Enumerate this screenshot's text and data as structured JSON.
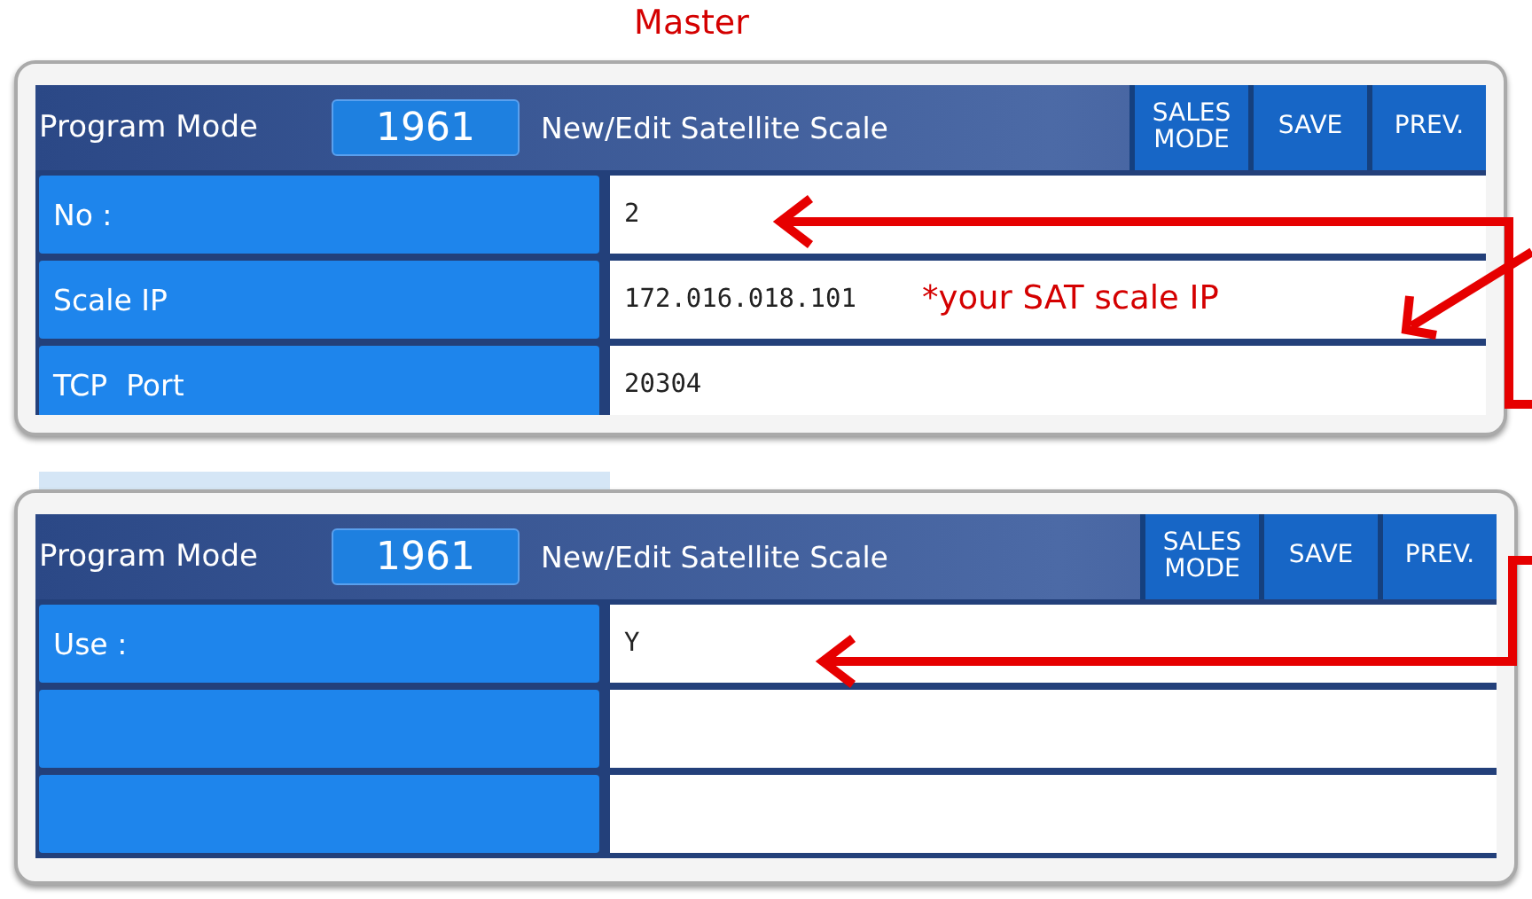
{
  "caption": "Master",
  "panels": [
    {
      "mode_label": "Program Mode",
      "code": "1961",
      "title": "New/Edit Satellite Scale",
      "buttons": [
        {
          "label": "SALES MODE"
        },
        {
          "label": "SAVE"
        },
        {
          "label": "PREV."
        }
      ],
      "rows": [
        {
          "label": "No :",
          "value": "2"
        },
        {
          "label": "Scale IP",
          "value": "172.016.018.101"
        },
        {
          "label": "TCP  Port",
          "value": "20304"
        }
      ]
    },
    {
      "mode_label": "Program Mode",
      "code": "1961",
      "title": "New/Edit Satellite Scale",
      "buttons": [
        {
          "label": "SALES MODE"
        },
        {
          "label": "SAVE"
        },
        {
          "label": "PREV."
        }
      ],
      "rows": [
        {
          "label": "Use :",
          "value": "Y"
        },
        {},
        {}
      ]
    }
  ],
  "note": "*your SAT scale IP"
}
